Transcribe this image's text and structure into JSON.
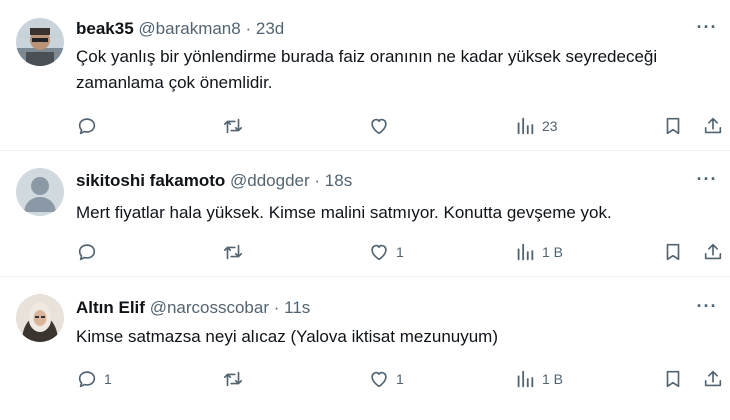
{
  "tweets": [
    {
      "name": "beak35",
      "handle": "@barakman8",
      "sep": "·",
      "time": "23d",
      "text": "Çok yanlış bir yönlendirme burada faiz oranının ne kadar yüksek seyredeceği zamanlama çok önemlidir.",
      "replies": "",
      "retweets": "",
      "likes": "",
      "views": "23"
    },
    {
      "name": "sikitoshi fakamoto",
      "handle": "@ddogder",
      "sep": "·",
      "time": "18s",
      "text": "Mert fiyatlar hala yüksek. Kimse malini satmıyor. Konutta gevşeme yok.",
      "replies": "",
      "retweets": "",
      "likes": "1",
      "views": "1 B"
    },
    {
      "name": "Altın Elif",
      "handle": "@narcosscobar",
      "sep": "·",
      "time": "11s",
      "text": "Kimse satmazsa neyi alıcaz (Yalova iktisat mezunuyum)",
      "replies": "1",
      "retweets": "",
      "likes": "1",
      "views": "1 B"
    }
  ],
  "icons": {
    "reply": "reply-icon",
    "retweet": "retweet-icon",
    "like": "like-icon",
    "views": "views-icon",
    "bookmark": "bookmark-icon",
    "share": "share-icon",
    "more": "more-icon"
  },
  "colors": {
    "text": "#0f1419",
    "secondary": "#536471",
    "divider": "#eff3f4"
  }
}
